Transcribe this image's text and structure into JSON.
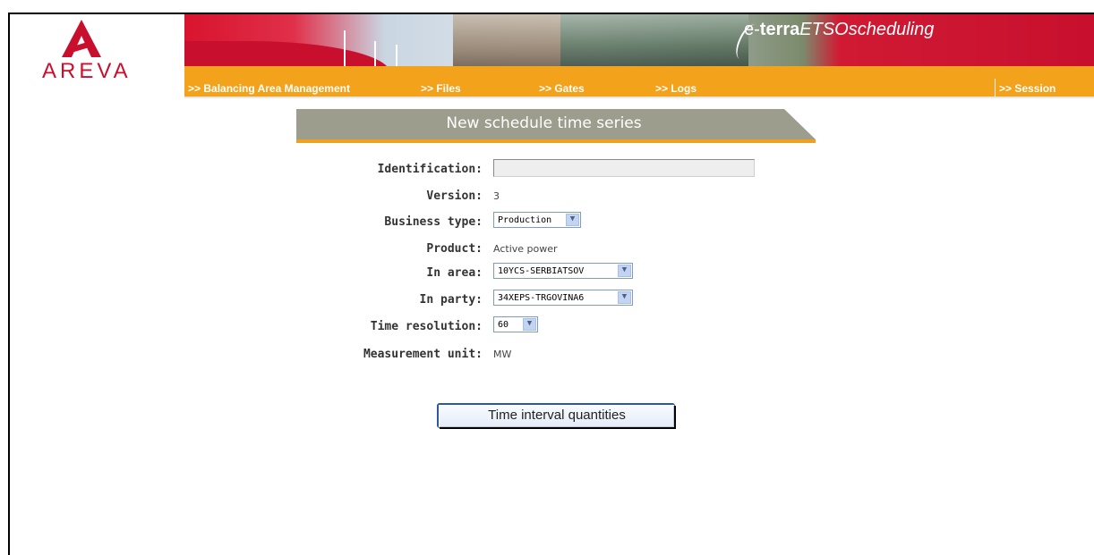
{
  "header": {
    "logo_text": "AREVA",
    "product_e": "e-",
    "product_terra": "terra",
    "product_name": "ETSOscheduling"
  },
  "nav": {
    "items": [
      {
        "label": ">> Balancing Area Management"
      },
      {
        "label": ">> Files"
      },
      {
        "label": ">> Gates"
      },
      {
        "label": ">> Logs"
      }
    ],
    "session": ">> Session"
  },
  "page": {
    "title": "New schedule time series"
  },
  "form": {
    "identification": {
      "label": "Identification:",
      "value": ""
    },
    "version": {
      "label": "Version:",
      "value": "3"
    },
    "business_type": {
      "label": "Business type:",
      "value": "Production"
    },
    "product": {
      "label": "Product:",
      "value": "Active power"
    },
    "in_area": {
      "label": "In area:",
      "value": "10YCS-SERBIATSOV"
    },
    "in_party": {
      "label": "In party:",
      "value": "34XEPS-TRGOVINA6"
    },
    "time_resolution": {
      "label": "Time resolution:",
      "value": "60"
    },
    "measurement_unit": {
      "label": "Measurement unit:",
      "value": "MW"
    }
  },
  "actions": {
    "time_interval_button": "Time interval quantities"
  },
  "colors": {
    "brand_red": "#c8102e",
    "nav_orange": "#f3a21b",
    "title_gray": "#9d9d8d"
  }
}
